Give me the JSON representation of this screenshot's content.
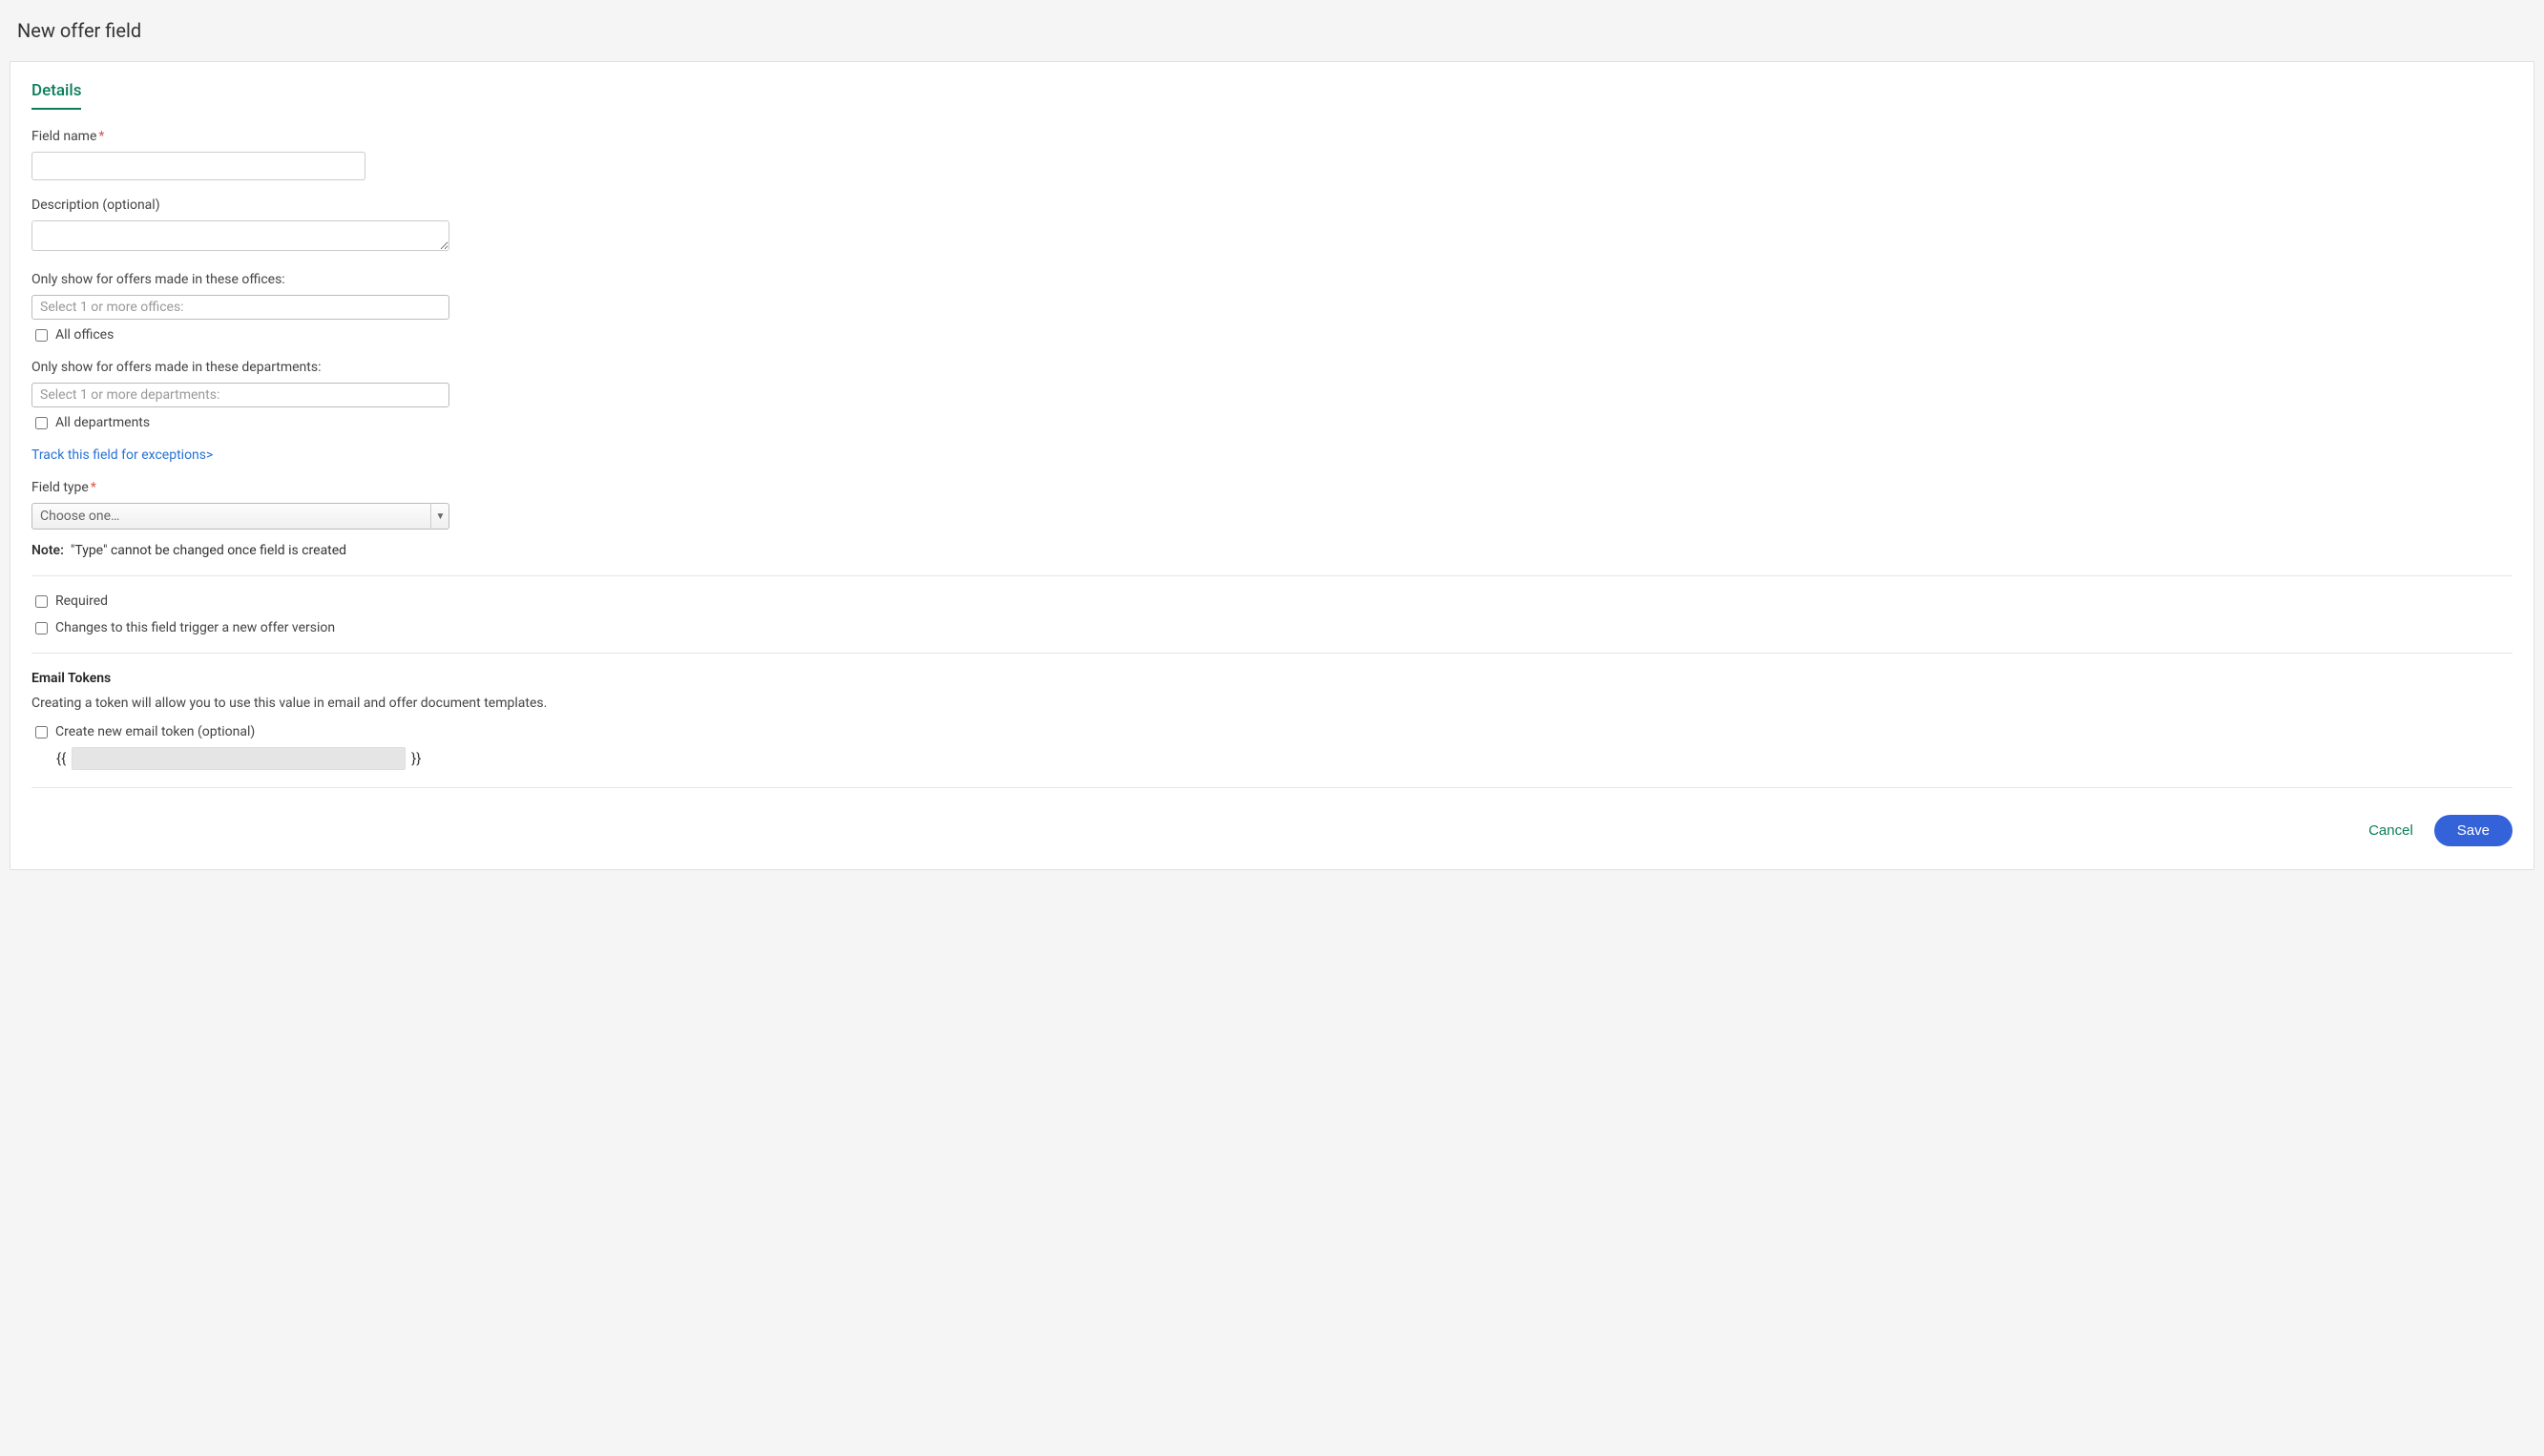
{
  "page": {
    "title": "New offer field"
  },
  "tabs": {
    "details": "Details"
  },
  "fields": {
    "fieldName": {
      "label": "Field name",
      "value": ""
    },
    "description": {
      "label": "Description (optional)",
      "value": ""
    },
    "offices": {
      "label": "Only show for offers made in these offices:",
      "placeholder": "Select 1 or more offices:",
      "allLabel": "All offices"
    },
    "departments": {
      "label": "Only show for offers made in these departments:",
      "placeholder": "Select 1 or more departments:",
      "allLabel": "All departments"
    },
    "trackExceptionsLink": "Track this field for exceptions>",
    "fieldType": {
      "label": "Field type",
      "placeholder": "Choose one…"
    },
    "note": {
      "label": "Note:",
      "text": "\"Type\" cannot be changed once field is created"
    },
    "required": {
      "label": "Required"
    },
    "triggerVersion": {
      "label": "Changes to this field trigger a new offer version"
    },
    "emailTokens": {
      "heading": "Email Tokens",
      "description": "Creating a token will allow you to use this value in email and offer document templates.",
      "createLabel": "Create new email token (optional)",
      "braceOpen": "{{",
      "braceClose": "}}",
      "tokenValue": ""
    }
  },
  "actions": {
    "cancel": "Cancel",
    "save": "Save"
  }
}
